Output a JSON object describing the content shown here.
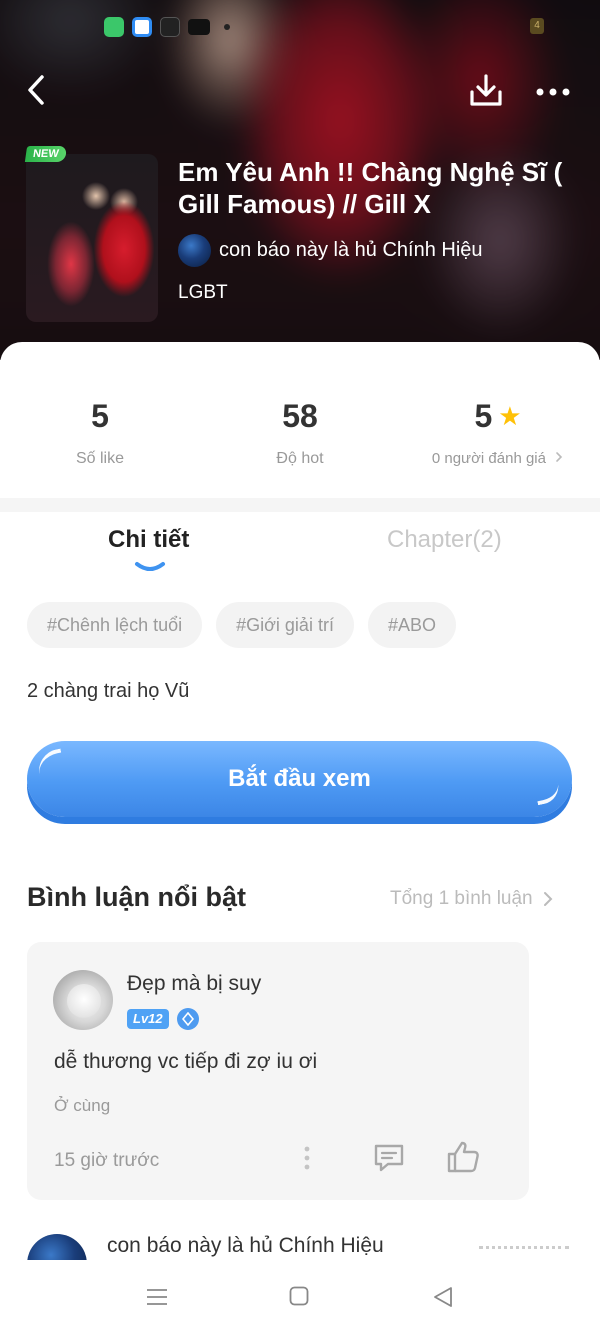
{
  "header": {
    "badge": "NEW",
    "title": "Em Yêu Anh !! Chàng Nghệ Sĩ ( Gill Famous) // Gill X",
    "author": "con báo này là hủ Chính Hiệu",
    "genre": "LGBT",
    "icons": [
      "back-arrow-icon",
      "download-icon",
      "more-dots-icon"
    ]
  },
  "status_bar": {
    "battery": "4",
    "app_icons": [
      "green-app-icon",
      "blue-app-icon",
      "bao-moi-icon",
      "youtube-icon"
    ]
  },
  "stats": {
    "likes_value": "5",
    "likes_label": "Số like",
    "hot_value": "58",
    "hot_label": "Độ hot",
    "rating_value": "5",
    "rating_label": "0 người đánh giá"
  },
  "tabs": {
    "details": "Chi tiết",
    "chapters": "Chapter(2)"
  },
  "tags": [
    "#Chênh lệch tuổi",
    "#Giới giải trí",
    "#ABO"
  ],
  "synopsis": "2 chàng trai họ Vũ",
  "start_button": "Bắt đầu xem",
  "comments_section": {
    "title": "Bình luận nổi bật",
    "total": "Tổng 1 bình luận"
  },
  "comment": {
    "user": "Đẹp mà bị suy",
    "level": "Lv12",
    "text": "dễ thương vc tiếp đi zợ iu ơi",
    "location": "Ở cùng",
    "time": "15 giờ trước"
  },
  "second_comment_user": "con báo này là hủ Chính Hiệu",
  "colors": {
    "accent_blue": "#4e9af4",
    "star": "#ffc107",
    "new_badge": "#2bb34a"
  }
}
